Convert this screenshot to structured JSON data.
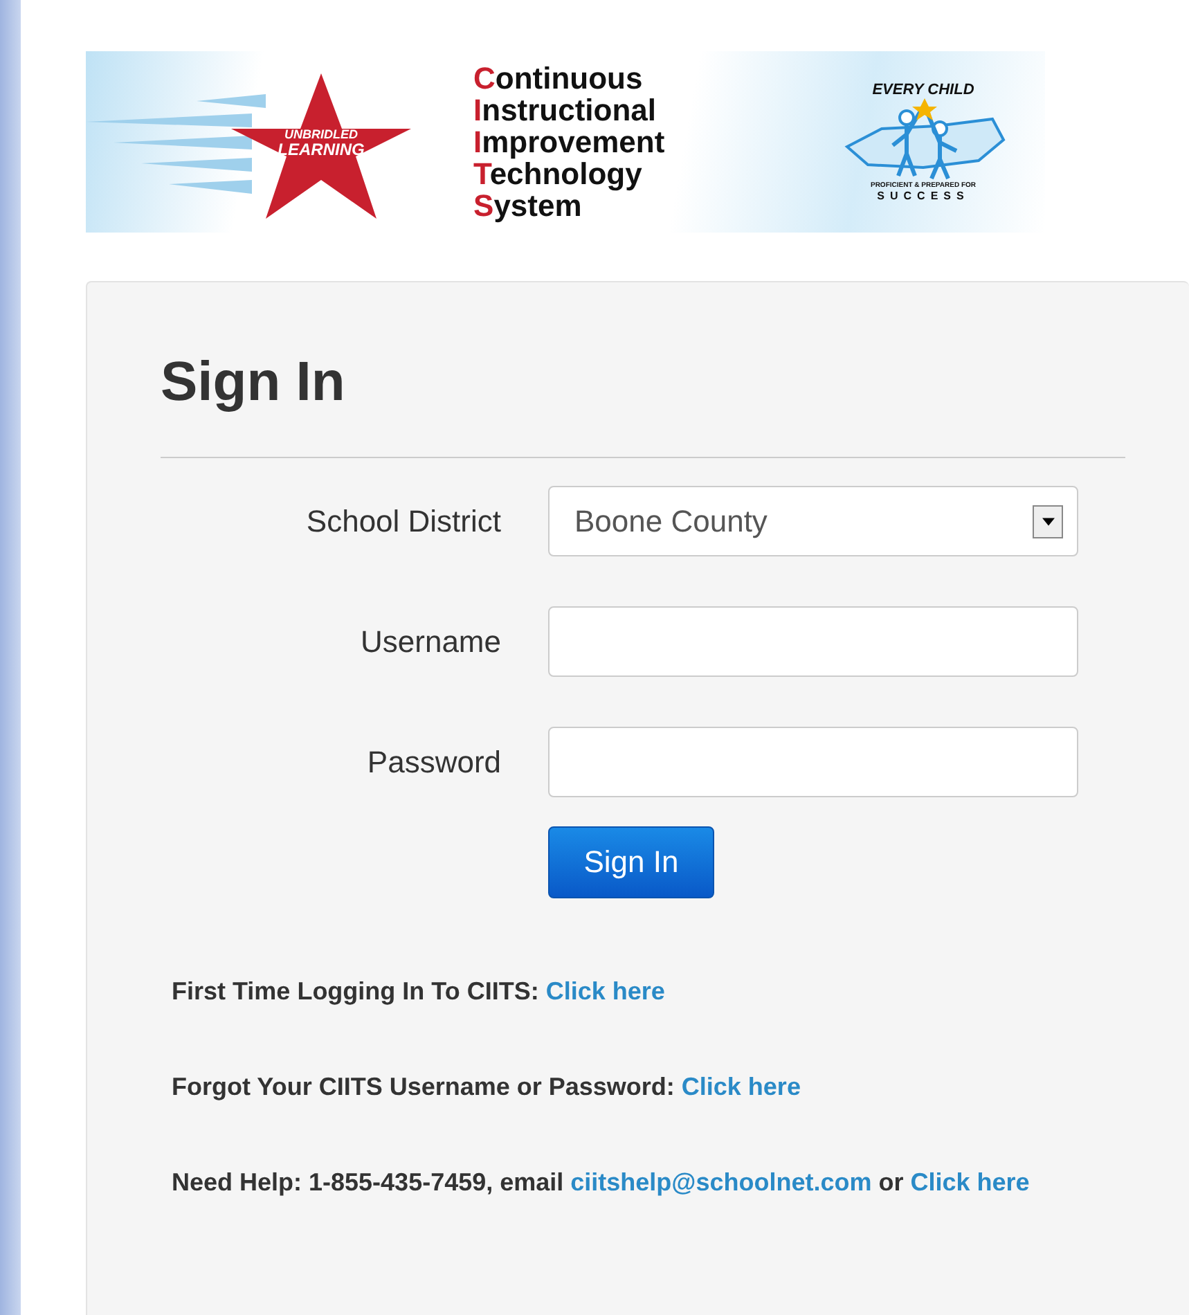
{
  "banner": {
    "left_logo": {
      "line1": "UNBRIDLED",
      "line2": "LEARNING"
    },
    "title_lines": [
      "Continuous",
      "Instructional",
      "Improvement",
      "Technology",
      "System"
    ],
    "right_logo": {
      "top": "EVERY CHILD",
      "tagline": "PROFICIENT & PREPARED FOR",
      "bottom": "SUCCESS"
    }
  },
  "form": {
    "heading": "Sign In",
    "fields": [
      {
        "kind": "select",
        "label": "School District",
        "value": "Boone County"
      },
      {
        "kind": "text",
        "label": "Username"
      },
      {
        "kind": "password",
        "label": "Password"
      }
    ],
    "submit": "Sign In"
  },
  "help_lines": [
    [
      {
        "text": "First Time Logging In To CIITS: ",
        "link": false
      },
      {
        "text": "Click here",
        "link": true
      }
    ],
    [
      {
        "text": "Forgot Your CIITS Username or Password: ",
        "link": false
      },
      {
        "text": "Click here",
        "link": true
      }
    ],
    [
      {
        "text": "Need Help: 1-855-435-7459, email ",
        "link": false
      },
      {
        "text": "ciitshelp@schoolnet.com",
        "link": true
      },
      {
        "text": " or ",
        "link": false
      },
      {
        "text": "Click here",
        "link": true
      }
    ]
  ]
}
